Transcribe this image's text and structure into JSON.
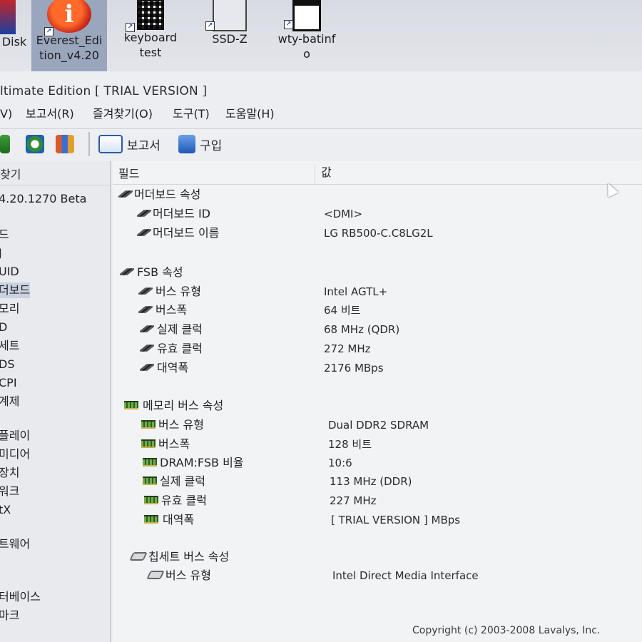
{
  "desktop": {
    "icons": [
      {
        "label_1": "Disk",
        "label_2": ""
      },
      {
        "label_1": "Everest_Edi",
        "label_2": "tion_v4.20"
      },
      {
        "label_1": "keyboard",
        "label_2": "test"
      },
      {
        "label_1": "SSD-Z",
        "label_2": ""
      },
      {
        "label_1": "wty-batinf",
        "label_2": "o"
      }
    ]
  },
  "window": {
    "title": "ltimate Edition  [ TRIAL VERSION ]"
  },
  "menu": {
    "view": "V)",
    "report": "보고서(R)",
    "favorites": "즐겨찾기(O)",
    "tools": "도구(T)",
    "help": "도움말(H)"
  },
  "toolbar": {
    "report": "보고서",
    "buy": "구입"
  },
  "tree": {
    "header": "찾기",
    "items": [
      "4.20.1270 Beta",
      "드",
      "J",
      "UID",
      "더보드",
      "모리",
      "D",
      "세트",
      "DS",
      "CPI",
      "계제",
      "플레이",
      "미디어",
      "장치",
      "워크",
      "tX",
      "트웨어",
      "터베이스",
      "마크"
    ]
  },
  "list": {
    "col_field": "필드",
    "col_value": "값",
    "rows": [
      {
        "field": "머더보드 속성",
        "value": ""
      },
      {
        "field": "머더보드 ID",
        "value": "<DMI>"
      },
      {
        "field": "머더보드 이름",
        "value": "LG RB500-C.C8LG2L"
      },
      {
        "field": "FSB 속성",
        "value": ""
      },
      {
        "field": "버스 유형",
        "value": "Intel AGTL+"
      },
      {
        "field": "버스폭",
        "value": "64 비트"
      },
      {
        "field": "실제 클럭",
        "value": "68 MHz (QDR)"
      },
      {
        "field": "유효 클럭",
        "value": "272 MHz"
      },
      {
        "field": "대역폭",
        "value": "2176 MBps"
      },
      {
        "field": "메모리 버스 속성",
        "value": ""
      },
      {
        "field": "버스 유형",
        "value": "Dual DDR2 SDRAM"
      },
      {
        "field": "버스폭",
        "value": "128 비트"
      },
      {
        "field": "DRAM:FSB 비율",
        "value": "10:6"
      },
      {
        "field": "실제 클럭",
        "value": "113 MHz (DDR)"
      },
      {
        "field": "유효 클럭",
        "value": "227 MHz"
      },
      {
        "field": "대역폭",
        "value": "[ TRIAL VERSION ] MBps"
      },
      {
        "field": "칩세트 버스 속성",
        "value": ""
      },
      {
        "field": "버스 유형",
        "value": "Intel Direct Media Interface"
      }
    ]
  },
  "footer": "Copyright (c) 2003-2008 Lavalys, Inc."
}
